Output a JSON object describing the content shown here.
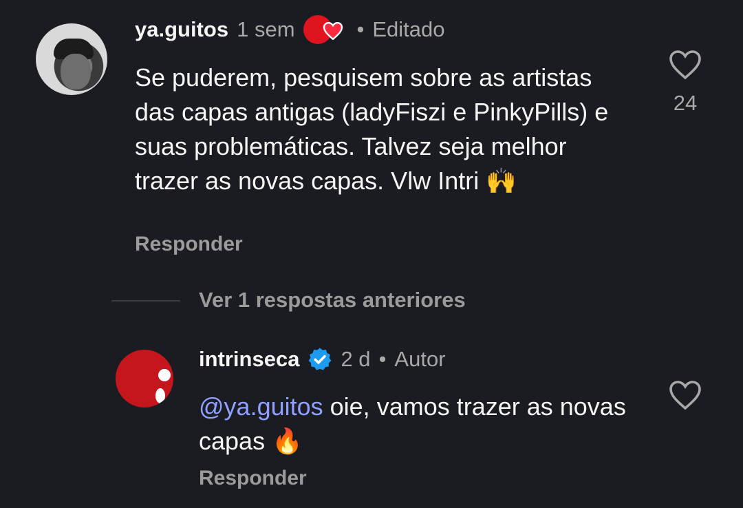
{
  "comment": {
    "username": "ya.guitos",
    "time": "1 sem",
    "separator": "•",
    "edited_label": "Editado",
    "text": "Se puderem, pesquisem sobre as artistas das capas antigas (ladyFiszi e PinkyPills) e suas problemáticas. Talvez seja melhor trazer as novas capas. Vlw Intri 🙌",
    "like_count": "24",
    "reply_label": "Responder"
  },
  "replies_toggle": {
    "label": "Ver 1 respostas anteriores"
  },
  "reply": {
    "username": "intrinseca",
    "time": "2 d",
    "separator": "•",
    "author_label": "Autor",
    "mention_symbol": "@",
    "mention": "ya.guitos",
    "text": " oie, vamos trazer as novas capas 🔥",
    "reply_label": "Responder"
  },
  "icons": [
    "heart-icon",
    "verified-icon",
    "threads-mention-icon"
  ],
  "colors": {
    "background": "#1b1c21",
    "brand_red": "#c4161c",
    "verified_blue": "#1d9bf0",
    "mention": "#8fa0ff"
  }
}
